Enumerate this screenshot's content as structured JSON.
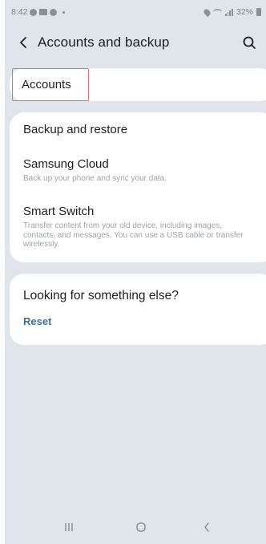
{
  "status_bar": {
    "time": "8:42",
    "battery": "32%"
  },
  "header": {
    "title": "Accounts and backup",
    "back_icon": "chevron-left",
    "search_icon": "search"
  },
  "accounts": {
    "label": "Accounts"
  },
  "backup_section": {
    "items": [
      {
        "title": "Backup and restore",
        "subtitle": ""
      },
      {
        "title": "Samsung Cloud",
        "subtitle": "Back up your phone and sync your data."
      },
      {
        "title": "Smart Switch",
        "subtitle": "Transfer content from your old device, including images, contacts, and messages. You can use a USB cable or transfer wirelessly."
      }
    ]
  },
  "suggestions": {
    "title": "Looking for something else?",
    "link": "Reset"
  },
  "colors": {
    "background": "#dfe5ea",
    "card": "#ffffff",
    "link": "#3e6f9a",
    "highlight": "#d9707f"
  }
}
